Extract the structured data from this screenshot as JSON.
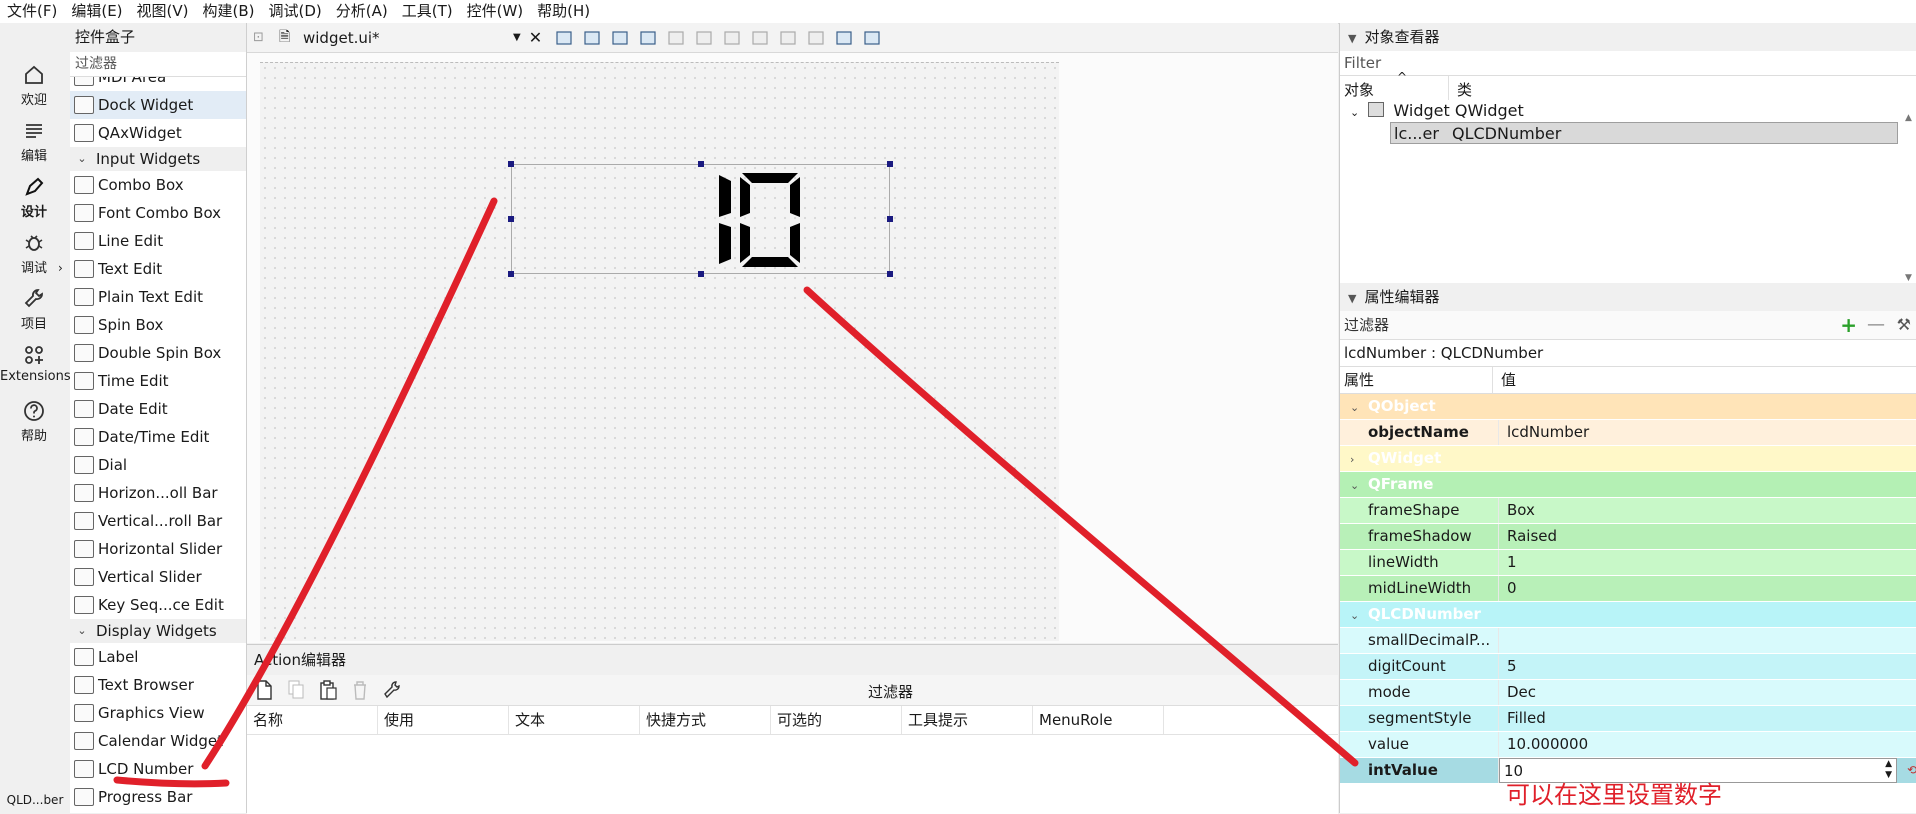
{
  "menu": [
    "文件(F)",
    "编辑(E)",
    "视图(V)",
    "构建(B)",
    "调试(D)",
    "分析(A)",
    "工具(T)",
    "控件(W)",
    "帮助(H)"
  ],
  "modes": [
    {
      "label": "欢迎",
      "icon": "home-icon"
    },
    {
      "label": "编辑",
      "icon": "edit-lines-icon"
    },
    {
      "label": "设计",
      "icon": "pen-icon"
    },
    {
      "label": "调试",
      "icon": "bug-icon"
    },
    {
      "label": "项目",
      "icon": "wrench-icon"
    },
    {
      "label": "Extensions",
      "icon": "extensions-icon"
    },
    {
      "label": "帮助",
      "icon": "help-icon"
    }
  ],
  "mode_bottom": "QLD...ber",
  "widgetbox": {
    "title": "控件盒子",
    "filter": "过滤器",
    "items": [
      {
        "type": "item",
        "label": "MDI Area"
      },
      {
        "type": "item",
        "label": "Dock Widget",
        "selected": true
      },
      {
        "type": "item",
        "label": "QAxWidget"
      },
      {
        "type": "cat",
        "label": "Input Widgets"
      },
      {
        "type": "item",
        "label": "Combo Box"
      },
      {
        "type": "item",
        "label": "Font Combo Box"
      },
      {
        "type": "item",
        "label": "Line Edit"
      },
      {
        "type": "item",
        "label": "Text Edit"
      },
      {
        "type": "item",
        "label": "Plain Text Edit"
      },
      {
        "type": "item",
        "label": "Spin Box"
      },
      {
        "type": "item",
        "label": "Double Spin Box"
      },
      {
        "type": "item",
        "label": "Time Edit"
      },
      {
        "type": "item",
        "label": "Date Edit"
      },
      {
        "type": "item",
        "label": "Date/Time Edit"
      },
      {
        "type": "item",
        "label": "Dial"
      },
      {
        "type": "item",
        "label": "Horizon...oll Bar"
      },
      {
        "type": "item",
        "label": "Vertical...roll Bar"
      },
      {
        "type": "item",
        "label": "Horizontal Slider"
      },
      {
        "type": "item",
        "label": "Vertical Slider"
      },
      {
        "type": "item",
        "label": "Key Seq...ce Edit"
      },
      {
        "type": "cat",
        "label": "Display Widgets"
      },
      {
        "type": "item",
        "label": "Label"
      },
      {
        "type": "item",
        "label": "Text Browser"
      },
      {
        "type": "item",
        "label": "Graphics View"
      },
      {
        "type": "item",
        "label": "Calendar Widget"
      },
      {
        "type": "item",
        "label": "LCD Number"
      },
      {
        "type": "item",
        "label": "Progress Bar"
      }
    ]
  },
  "editor": {
    "file": "widget.ui*"
  },
  "lcd": {
    "display": "10"
  },
  "action_editor": {
    "title": "Action编辑器",
    "filter": "过滤器",
    "columns": [
      "名称",
      "使用",
      "文本",
      "快捷方式",
      "可选的",
      "工具提示",
      "MenuRole"
    ]
  },
  "object_inspector": {
    "title": "对象查看器",
    "filter": "Filter",
    "col_object": "对象",
    "col_class": "类",
    "rows": [
      {
        "object": "Widget",
        "class": "QWidget"
      },
      {
        "object": "lc...er",
        "class": "QLCDNumber"
      }
    ]
  },
  "property_editor": {
    "title": "属性编辑器",
    "filter": "过滤器",
    "class_line": "lcdNumber : QLCDNumber",
    "col_prop": "属性",
    "col_value": "值",
    "rows": [
      {
        "group": true,
        "name": "QObject",
        "color": "#ffe4b8",
        "open": true
      },
      {
        "name": "objectName",
        "value": "lcdNumber",
        "color": "#fff0dc",
        "bold": true
      },
      {
        "group": true,
        "name": "QWidget",
        "color": "#fff8c8",
        "open": false
      },
      {
        "group": true,
        "name": "QFrame",
        "color": "#b4f0b4",
        "open": true
      },
      {
        "name": "frameShape",
        "value": "Box",
        "color": "#c8f8c8"
      },
      {
        "name": "frameShadow",
        "value": "Raised",
        "color": "#b8f0b8"
      },
      {
        "name": "lineWidth",
        "value": "1",
        "color": "#c8f8c8"
      },
      {
        "name": "midLineWidth",
        "value": "0",
        "color": "#b8f0b8"
      },
      {
        "group": true,
        "name": "QLCDNumber",
        "color": "#b8f4f8",
        "open": true
      },
      {
        "name": "smallDecimalP...",
        "value": "",
        "color": "#d8fafc"
      },
      {
        "name": "digitCount",
        "value": "5",
        "color": "#c4f4f8"
      },
      {
        "name": "mode",
        "value": "Dec",
        "color": "#d8fafc"
      },
      {
        "name": "segmentStyle",
        "value": "Filled",
        "color": "#c4f4f8"
      },
      {
        "name": "value",
        "value": "10.000000",
        "color": "#d8fafc"
      },
      {
        "name": "intValue",
        "value": "10",
        "color": "#a6dbe3",
        "bold": true,
        "editing": true
      }
    ]
  },
  "annotation": "可以在这里设置数字",
  "colors": {
    "annotation": "#e0202a",
    "selection": "#1a1a80"
  }
}
